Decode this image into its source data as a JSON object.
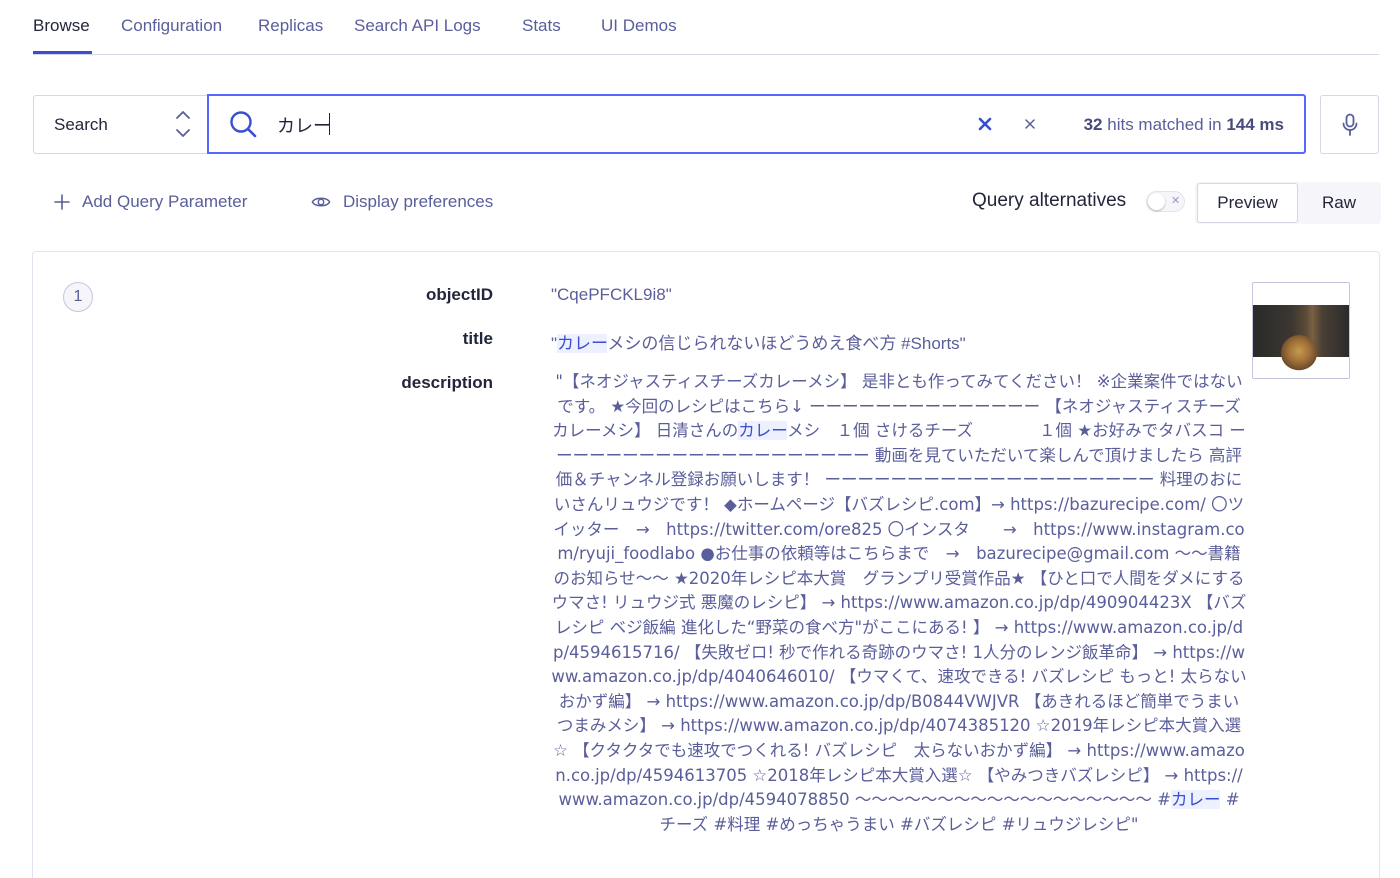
{
  "tabs": [
    {
      "label": "Browse",
      "active": true
    },
    {
      "label": "Configuration"
    },
    {
      "label": "Replicas"
    },
    {
      "label": "Search API Logs"
    },
    {
      "label": "Stats"
    },
    {
      "label": "UI Demos"
    }
  ],
  "search": {
    "mode_label": "Search",
    "query": "カレー",
    "hits_count": "32",
    "hits_text": "hits matched in",
    "hits_time": "144 ms"
  },
  "actions": {
    "add_param": "Add Query Parameter",
    "display_prefs": "Display preferences",
    "query_alternatives": "Query alternatives",
    "query_alternatives_enabled": false,
    "preview_label": "Preview",
    "raw_label": "Raw",
    "active_view": "Preview"
  },
  "result": {
    "rank": "1",
    "fields": {
      "objectID_key": "objectID",
      "objectID_value": "\"CqePFCKL9i8\"",
      "title_key": "title",
      "title_prefix": "\"",
      "title_highlight": "カレー",
      "title_rest": "メシの信じられないほどうめえ食べ方 #Shorts\"",
      "description_key": "description",
      "description_part1": "\"【ネオジャスティスチーズカレーメシ】 是非とも作ってみてください！ ※企業案件ではないです。 ★今回のレシピはこちら↓ ーーーーーーーーーーーーーー 【ネオジャスティスチーズカレーメシ】 日清さんの",
      "description_hl1": "カレー",
      "description_part2": "メシ　１個 さけるチーズ　　　　１個 ★お好みでタバスコ ーーーーーーーーーーーーーーーーーーーー 動画を見ていただいて楽しんで頂けましたら 高評価＆チャンネル登録お願いします！ ーーーーーーーーーーーーーーーーーーーー 料理のおにいさんリュウジです！ ◆ホームページ【バズレシピ.com】→ https://bazurecipe.com/ 〇ツイッター　→　https://twitter.com/ore825 〇インスタ　　→　https://www.instagram.com/ryuji_foodlabo ●お仕事の依頼等はこちらまで　→　bazurecipe@gmail.com 〜〜書籍のお知らせ〜〜 ★2020年レシピ本大賞　グランプリ受賞作品★ 【ひと口で人間をダメにするウマさ! リュウジ式 悪魔のレシピ】 → https://www.amazon.co.jp/dp/490904423X 【バズレシピ ベジ飯編 進化した“野菜の食べ方\"がここにある! 】 → https://www.amazon.co.jp/dp/4594615716/ 【失敗ゼロ! 秒で作れる奇跡のウマさ! 1人分のレンジ飯革命】 → https://www.amazon.co.jp/dp/4040646010/ 【ウマくて、速攻できる! バズレシピ もっと! 太らないおかず編】 → https://www.amazon.co.jp/dp/B0844VWJVR 【あきれるほど簡単でうまい つまみメシ】 → https://www.amazon.co.jp/dp/4074385120 ☆2019年レシピ本大賞入選☆ 【クタクタでも速攻でつくれる! バズレシピ　太らないおかず編】 → https://www.amazon.co.jp/dp/4594613705 ☆2018年レシピ本大賞入選☆ 【やみつきバズレシピ】 → https://www.amazon.co.jp/dp/4594078850 〜〜〜〜〜〜〜〜〜〜〜〜〜〜〜〜〜〜 #",
      "description_hl2": "カレー",
      "description_part3": " #チーズ #料理 #めっちゃうまい #バズレシピ #リュウジレシピ\""
    }
  },
  "colors": {
    "accent": "#5468ff",
    "tab_active_underline": "#3a4fd0",
    "highlight_bg": "#ecf0ff",
    "muted_text": "#5a5e9a"
  },
  "icons": [
    "updown-icon",
    "search-icon",
    "clear-bold-icon",
    "clear-icon",
    "mic-icon",
    "plus-icon",
    "eye-icon",
    "close-icon"
  ]
}
